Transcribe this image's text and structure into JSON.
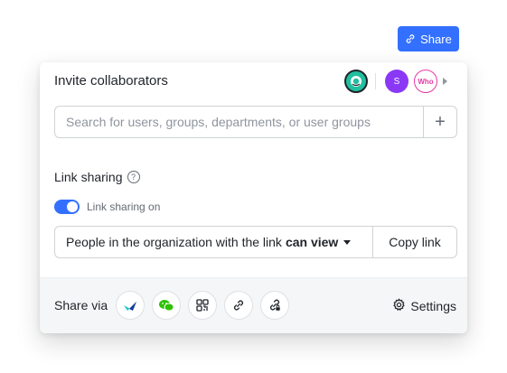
{
  "top_button": {
    "label": "Share",
    "icon": "link-icon"
  },
  "invite": {
    "title": "Invite collaborators",
    "avatars": [
      {
        "name": "app-avatar",
        "icon": "app-logo"
      },
      {
        "name": "user-s",
        "initial": "S",
        "color": "#8a38f5"
      },
      {
        "name": "user-who",
        "initial": "Who",
        "color": "#e43aa5"
      }
    ],
    "search_placeholder": "Search for users, groups, departments, or user groups",
    "add_label": "+"
  },
  "link_sharing": {
    "title": "Link sharing",
    "toggle_label": "Link sharing on",
    "toggle_on": true,
    "permission_prefix": "People in the organization with the link",
    "permission_level": "can view",
    "copy_label": "Copy link"
  },
  "footer": {
    "share_via_label": "Share via",
    "share_targets": [
      "lark-icon",
      "wechat-icon",
      "qrcode-icon",
      "link-icon",
      "link-secure-icon"
    ],
    "settings_label": "Settings"
  },
  "colors": {
    "accent": "#3370ff",
    "text": "#1f2329",
    "muted": "#646a73",
    "border": "#d0d3d6"
  }
}
